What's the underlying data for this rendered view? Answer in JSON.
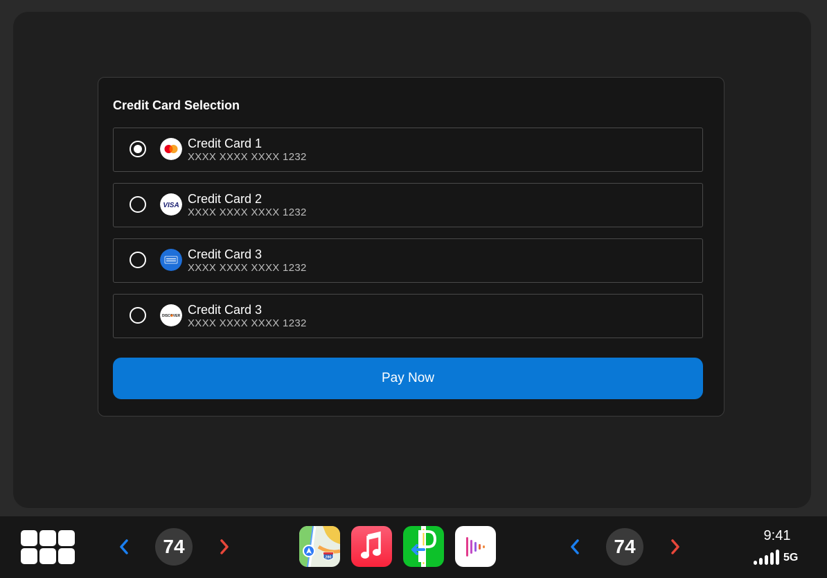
{
  "panel": {
    "title": "Credit Card Selection",
    "cards": [
      {
        "name": "Credit Card 1",
        "number": "XXXX XXXX XXXX 1232",
        "brand": "mastercard-icon",
        "selected": true
      },
      {
        "name": "Credit Card 2",
        "number": "XXXX XXXX XXXX 1232",
        "brand": "visa-icon",
        "selected": false
      },
      {
        "name": "Credit Card 3",
        "number": "XXXX XXXX XXXX 1232",
        "brand": "amex-icon",
        "selected": false
      },
      {
        "name": "Credit Card 3",
        "number": "XXXX XXXX XXXX 1232",
        "brand": "discover-icon",
        "selected": false
      }
    ],
    "brand_labels": {
      "visa": "VISA",
      "discover": "DISCOVER"
    },
    "pay_label": "Pay Now"
  },
  "dock": {
    "left_temp": "74",
    "right_temp": "74",
    "apps": [
      "maps-app-icon",
      "music-app-icon",
      "parking-app-icon",
      "podcast-app-icon"
    ],
    "maps_shield": "280",
    "time": "9:41",
    "network": "5G"
  },
  "colors": {
    "accent": "#0a78d6",
    "chevron_left": "#1a7ff0",
    "chevron_right": "#e8473a"
  }
}
